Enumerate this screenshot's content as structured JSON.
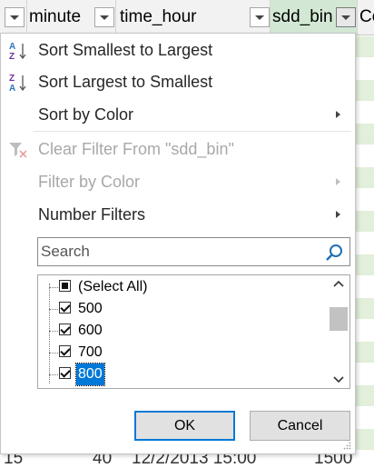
{
  "columns": {
    "c1_label": "",
    "minute_label": "minute",
    "time_hour_label": "time_hour",
    "sdd_bin_label": "sdd_bin",
    "next_label": "Co"
  },
  "menu": {
    "sort_asc": "Sort Smallest to Largest",
    "sort_desc": "Sort Largest to Smallest",
    "sort_by_color": "Sort by Color",
    "clear_filter": "Clear Filter From \"sdd_bin\"",
    "filter_by_color": "Filter by Color",
    "number_filters": "Number Filters"
  },
  "icons": {
    "sort_asc_top": "A",
    "sort_asc_bottom": "Z",
    "sort_desc_top": "Z",
    "sort_desc_bottom": "A"
  },
  "search": {
    "placeholder": "Search",
    "value": ""
  },
  "list": {
    "items": [
      {
        "label": "(Select All)",
        "state": "partial"
      },
      {
        "label": "500",
        "state": "checked"
      },
      {
        "label": "600",
        "state": "checked"
      },
      {
        "label": "700",
        "state": "checked"
      },
      {
        "label": "800",
        "state": "checked",
        "selected": true
      }
    ]
  },
  "buttons": {
    "ok": "OK",
    "cancel": "Cancel"
  },
  "bottom_row": {
    "c1": "15",
    "minute": "40",
    "time_hour": "12/2/2013 15:00",
    "sdd_bin": "1500"
  },
  "colors": {
    "accent": "#0078d7",
    "header_selected": "#d3e8d4",
    "cell_green": "#e2efda",
    "sort_icon_blue": "#2e75b6",
    "sort_icon_purple": "#7030a0"
  }
}
